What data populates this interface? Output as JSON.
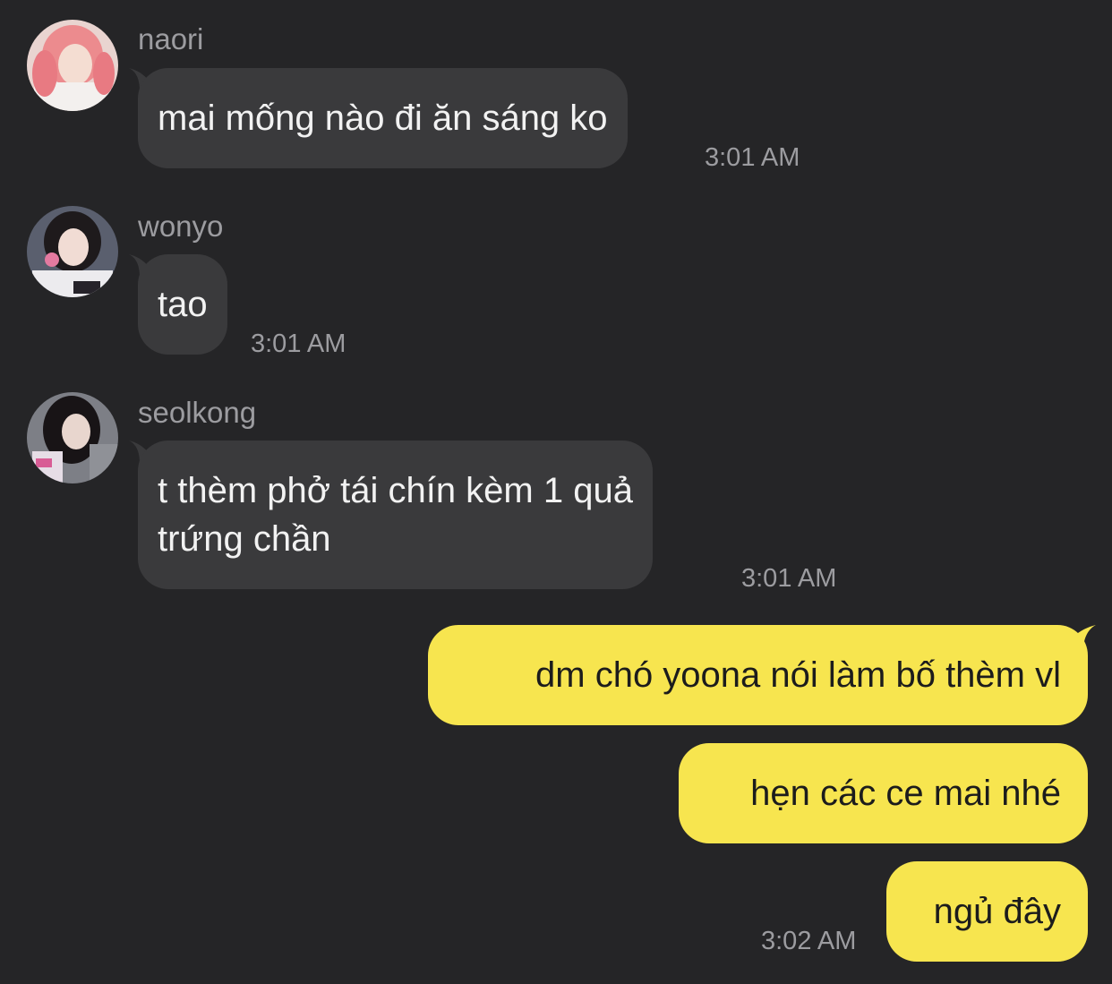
{
  "colors": {
    "background": "#252527",
    "incoming_bubble": "#3a3a3c",
    "outgoing_bubble": "#f7e54f",
    "meta_text": "#9c9ca0"
  },
  "messages": [
    {
      "sender": "naori",
      "avatar_icon": "avatar-naori-icon",
      "text": "mai mống nào đi ăn sáng ko",
      "time": "3:01 AM"
    },
    {
      "sender": "wonyo",
      "avatar_icon": "avatar-wonyo-icon",
      "text": "tao",
      "time": "3:01 AM"
    },
    {
      "sender": "seolkong",
      "avatar_icon": "avatar-seolkong-icon",
      "text": "t thèm phở tái chín kèm 1 quả\ntrứng chần",
      "time": "3:01 AM"
    }
  ],
  "outgoing": [
    {
      "text": "dm chó yoona nói làm bố thèm vl"
    },
    {
      "text": "hẹn các ce mai nhé"
    },
    {
      "text": "ngủ đây",
      "time": "3:02 AM"
    }
  ]
}
